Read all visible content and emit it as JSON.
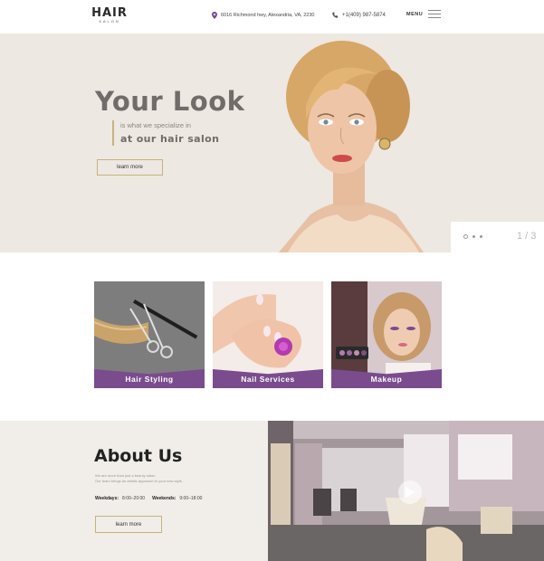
{
  "header": {
    "logo_main": "HAIR",
    "logo_sub": "SALON",
    "address": "6016 Richmond hwy, Alexandria, VA, 2230",
    "phone": "+1(409) 987-5874",
    "menu_label": "MENU"
  },
  "hero": {
    "title": "Your Look",
    "subtitle_line1": "is what we specialize in",
    "subtitle_line2": "at our hair salon",
    "button_label": "learn more",
    "slide_counter": "1 / 3"
  },
  "services": [
    {
      "label": "Hair Styling"
    },
    {
      "label": "Nail Services"
    },
    {
      "label": "Makeup"
    }
  ],
  "about": {
    "title": "About Us",
    "text": "We are more than just a beauty salon.\nOur team brings an artistic approach to your new style.",
    "weekdays_label": "Weekdays:",
    "weekdays_hours": "8:00–20:00",
    "weekends_label": "Weekends:",
    "weekends_hours": "9:00–18:00",
    "button_label": "learn more"
  },
  "colors": {
    "accent_purple": "#7a4c8e",
    "accent_gold": "#c9b27c",
    "hero_bg": "#ede8e1"
  }
}
